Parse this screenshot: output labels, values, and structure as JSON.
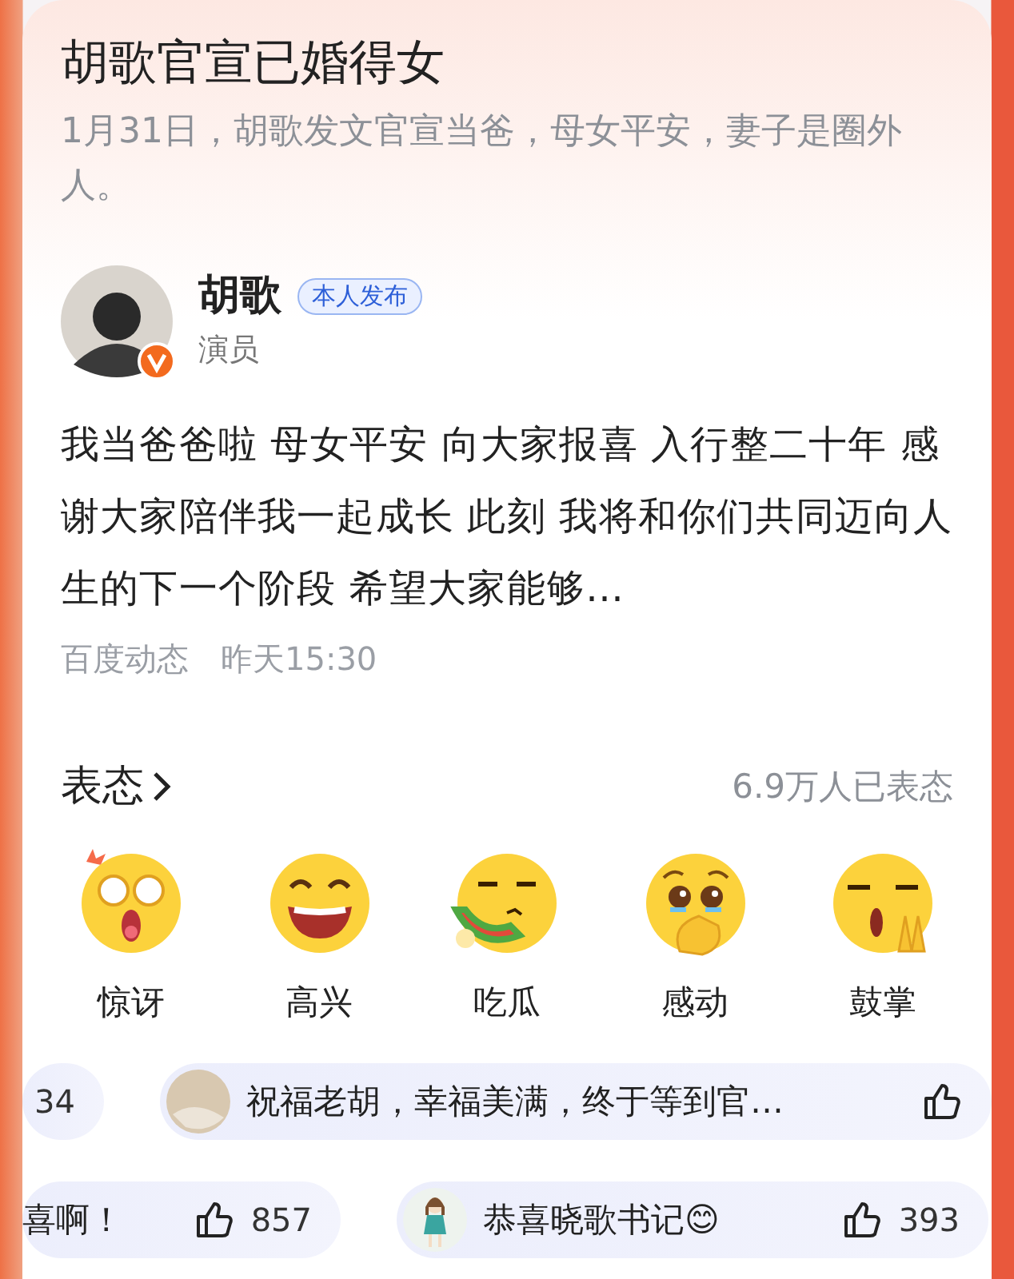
{
  "headline": {
    "title": "胡歌官宣已婚得女",
    "summary": "1月31日，胡歌发文官宣当爸，母女平安，妻子是圈外人。"
  },
  "post": {
    "author": "胡歌",
    "badge": "本人发布",
    "role": "演员",
    "verified": true,
    "text": "我当爸爸啦 母女平安 向大家报喜 入行整二十年 感谢大家陪伴我一起成长 此刻 我将和你们共同迈向人生的下一个阶段 希望大家能够…",
    "source": "百度动态",
    "time": "昨天15:30"
  },
  "reactions": {
    "title": "表态",
    "count": "6.9万人已表态",
    "items": [
      {
        "label": "惊讶",
        "kind": "surprised"
      },
      {
        "label": "高兴",
        "kind": "happy"
      },
      {
        "label": "吃瓜",
        "kind": "melon"
      },
      {
        "label": "感动",
        "kind": "moved"
      },
      {
        "label": "鼓掌",
        "kind": "clap"
      }
    ]
  },
  "comments": [
    [
      {
        "kind": "plain",
        "likes": "34"
      },
      {
        "kind": "photo",
        "text": "祝福老胡，幸福美满，终于等到官…"
      }
    ],
    [
      {
        "kind": "plain",
        "text": "喜啊！",
        "likes": "857"
      },
      {
        "kind": "girl",
        "text": "恭喜晓歌书记😊",
        "likes": "393"
      }
    ]
  ]
}
